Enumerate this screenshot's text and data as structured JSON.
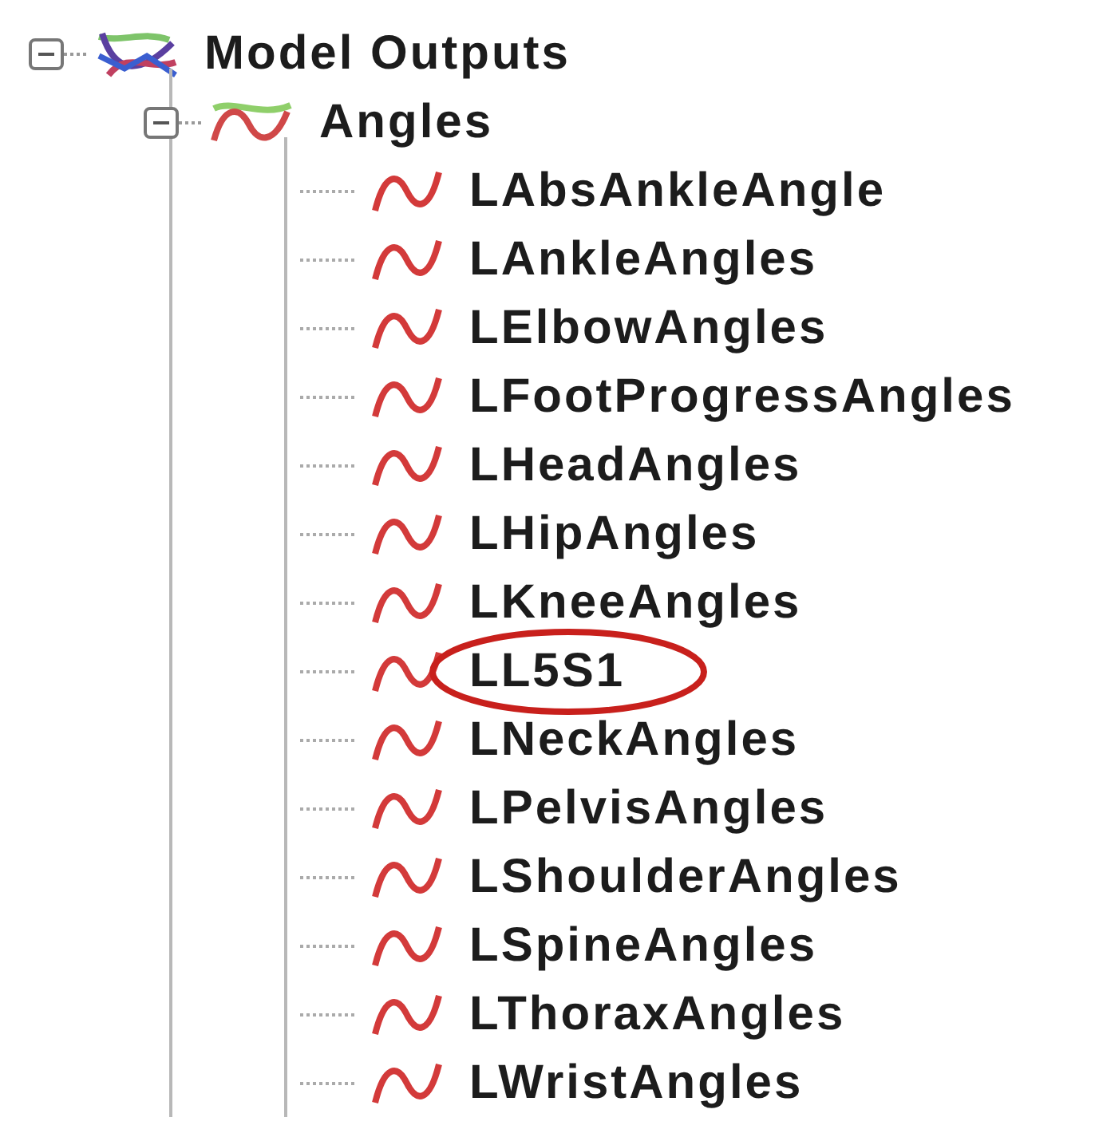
{
  "tree": [
    {
      "label": "Model Outputs",
      "kind": "group",
      "expanded": true,
      "children": [
        {
          "label": "Angles",
          "kind": "category",
          "expanded": true,
          "children": [
            {
              "label": "LAbsAnkleAngle",
              "kind": "output",
              "circled": false
            },
            {
              "label": "LAnkleAngles",
              "kind": "output",
              "circled": false
            },
            {
              "label": "LElbowAngles",
              "kind": "output",
              "circled": false
            },
            {
              "label": "LFootProgressAngles",
              "kind": "output",
              "circled": false
            },
            {
              "label": "LHeadAngles",
              "kind": "output",
              "circled": false
            },
            {
              "label": "LHipAngles",
              "kind": "output",
              "circled": false
            },
            {
              "label": "LKneeAngles",
              "kind": "output",
              "circled": false
            },
            {
              "label": "LL5S1",
              "kind": "output",
              "circled": true
            },
            {
              "label": "LNeckAngles",
              "kind": "output",
              "circled": false
            },
            {
              "label": "LPelvisAngles",
              "kind": "output",
              "circled": false
            },
            {
              "label": "LShoulderAngles",
              "kind": "output",
              "circled": false
            },
            {
              "label": "LSpineAngles",
              "kind": "output",
              "circled": false
            },
            {
              "label": "LThoraxAngles",
              "kind": "output",
              "circled": false
            },
            {
              "label": "LWristAngles",
              "kind": "output",
              "circled": false
            }
          ]
        }
      ]
    }
  ]
}
